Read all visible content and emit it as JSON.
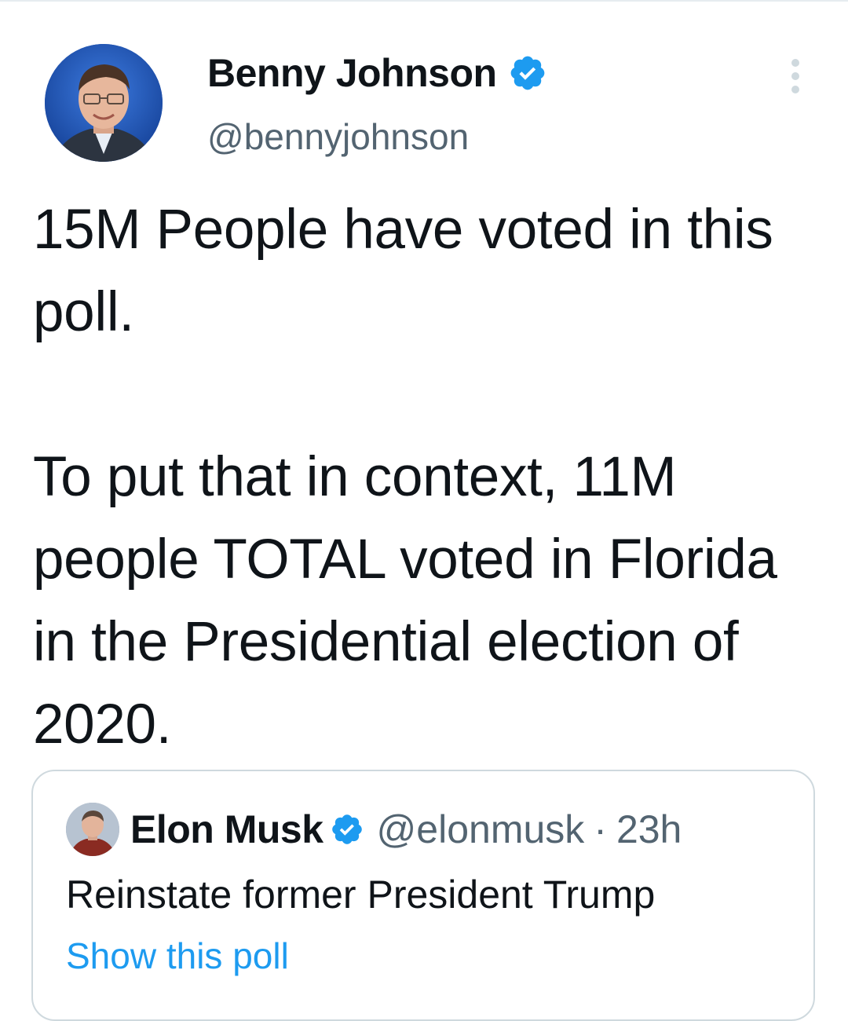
{
  "tweet": {
    "author_name": "Benny Johnson",
    "author_handle": "@bennyjohnson",
    "verified": true,
    "paragraphs": [
      "15M People have voted in this poll.",
      "To put that in context, 11M people TOTAL voted in Florida in the Presidential election of 2020."
    ]
  },
  "quoted_tweet": {
    "author_name": "Elon Musk",
    "author_handle": "@elonmusk",
    "separator": "·",
    "time": "23h",
    "text": "Reinstate former President Trump",
    "link_label": "Show this poll"
  },
  "icons": {
    "verified": "verified-badge-icon",
    "more": "more-options-icon"
  },
  "colors": {
    "verified_blue": "#1d9bf0",
    "link_blue": "#1d9bf0",
    "secondary_text": "#536471",
    "border": "#cfd9de"
  }
}
